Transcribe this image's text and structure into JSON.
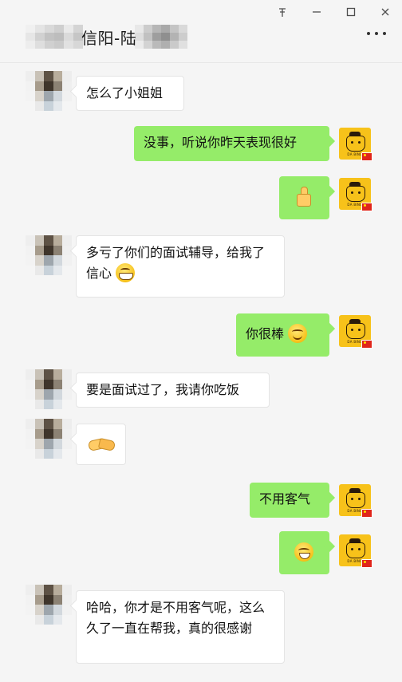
{
  "window": {
    "title_visible": "信阳-陆",
    "controls": [
      "pin",
      "minimize",
      "maximize",
      "close"
    ]
  },
  "contact": {
    "avatar_label": "DA BING"
  },
  "messages": [
    {
      "side": "left",
      "text": "怎么了小姐姐"
    },
    {
      "side": "right",
      "text": "没事，听说你昨天表现很好"
    },
    {
      "side": "right",
      "emoji": "thumbs-up"
    },
    {
      "side": "left",
      "text": "多亏了你们的面试辅导，给我了信心",
      "emoji": "grin"
    },
    {
      "side": "right",
      "text": "你很棒",
      "emoji": "smile"
    },
    {
      "side": "left",
      "text": "要是面试过了，我请你吃饭"
    },
    {
      "side": "left",
      "emoji": "handshake"
    },
    {
      "side": "right",
      "text": "不用客气"
    },
    {
      "side": "right",
      "emoji": "laugh"
    },
    {
      "side": "left",
      "text": "哈哈，你才是不用客气呢，这么久了一直在帮我，真的很感谢"
    }
  ],
  "colors": {
    "bubble_self": "#95ec69",
    "bubble_other": "#ffffff",
    "background": "#f5f5f5"
  }
}
